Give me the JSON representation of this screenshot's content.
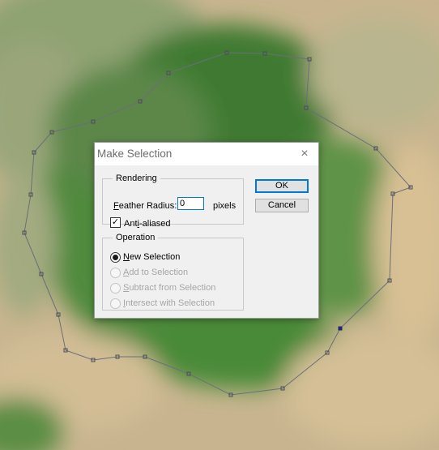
{
  "dialog": {
    "title": "Make Selection",
    "close_glyph": "×",
    "rendering": {
      "legend": "Rendering",
      "feather_label_mnemonic": "F",
      "feather_label_rest": "eather Radius:",
      "feather_value": "0",
      "feather_unit": "pixels",
      "antialias_checked": true,
      "antialias_label_pre": "Ant",
      "antialias_label_mnemonic": "i",
      "antialias_label_post": "-aliased"
    },
    "operation": {
      "legend": "Operation",
      "options": [
        {
          "mnemonic": "N",
          "rest": "ew Selection",
          "checked": true,
          "enabled": true
        },
        {
          "mnemonic": "A",
          "rest": "dd to Selection",
          "checked": false,
          "enabled": false
        },
        {
          "mnemonic": "S",
          "rest": "ubtract from Selection",
          "checked": false,
          "enabled": false
        },
        {
          "mnemonic": "I",
          "rest": "ntersect with Selection",
          "checked": false,
          "enabled": false
        }
      ]
    },
    "ok_label": "OK",
    "cancel_label": "Cancel"
  },
  "colors": {
    "accent": "#0078d7",
    "sand": "#c9b48e",
    "foliage": "#4f8a3c",
    "path_stroke": "#6b6f78"
  },
  "icons": {
    "close": "close-icon",
    "checkbox": "checkmark-icon"
  }
}
